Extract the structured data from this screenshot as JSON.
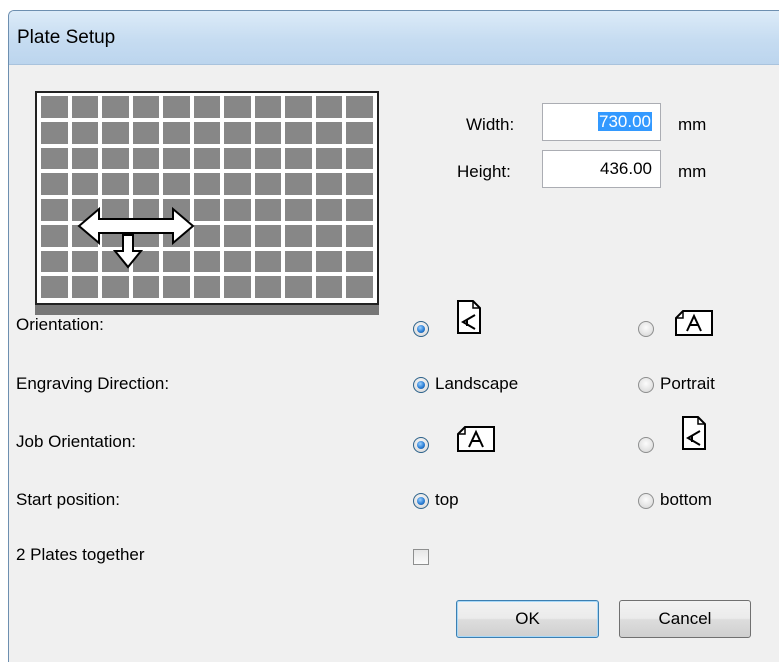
{
  "window": {
    "title": "Plate Setup"
  },
  "dimensions": {
    "width_label": "Width:",
    "width_value": "730.00",
    "width_unit": "mm",
    "height_label": "Height:",
    "height_value": "436.00",
    "height_unit": "mm"
  },
  "orientation": {
    "label": "Orientation:",
    "selected": "portrait-page",
    "options": [
      {
        "icon": "portrait-page-icon",
        "selected": true
      },
      {
        "icon": "landscape-page-icon",
        "selected": false
      }
    ]
  },
  "engraving_direction": {
    "label": "Engraving Direction:",
    "options": [
      {
        "label": "Landscape",
        "selected": true
      },
      {
        "label": "Portrait",
        "selected": false
      }
    ]
  },
  "job_orientation": {
    "label": "Job Orientation:",
    "options": [
      {
        "icon": "landscape-page-icon",
        "selected": true
      },
      {
        "icon": "portrait-page-icon",
        "selected": false
      }
    ]
  },
  "start_position": {
    "label": "Start position:",
    "options": [
      {
        "label": "top",
        "selected": true
      },
      {
        "label": "bottom",
        "selected": false
      }
    ]
  },
  "two_plates": {
    "label": "2 Plates together",
    "checked": false
  },
  "buttons": {
    "ok": "OK",
    "cancel": "Cancel"
  },
  "colors": {
    "titlebar": "#c6dcf1",
    "selection": "#3399ff",
    "plate_cell": "#878787"
  }
}
